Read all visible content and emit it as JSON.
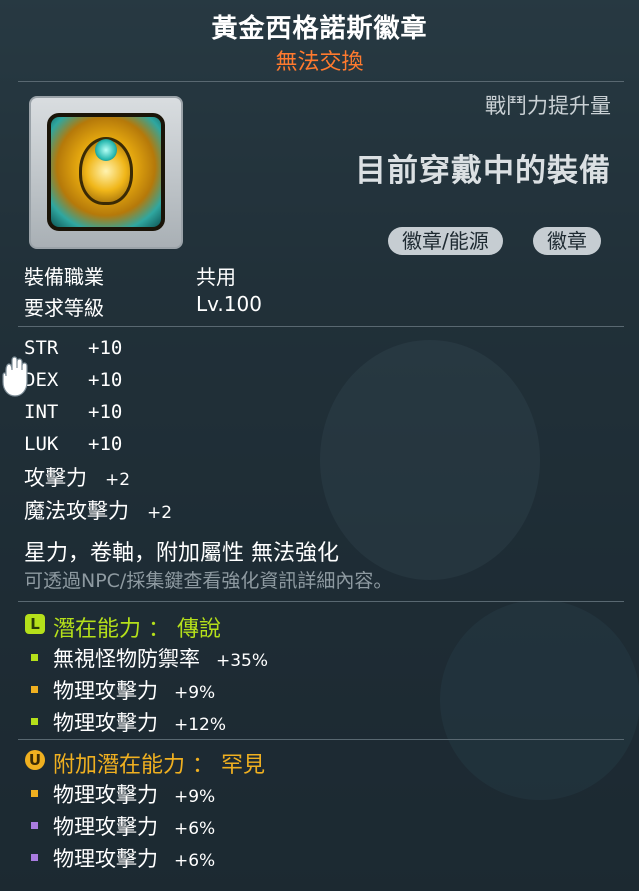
{
  "item": {
    "name": "黃金西格諾斯徽章",
    "trade_status": "無法交換",
    "icon": "golden-cygnus-badge-icon"
  },
  "power": {
    "label": "戰鬥力提升量",
    "equipped_text": "目前穿戴中的裝備"
  },
  "tags": [
    "徽章/能源",
    "徽章"
  ],
  "requirements": {
    "job_label": "裝備職業",
    "job_value": "共用",
    "level_label": "要求等級",
    "level_value": "Lv.100"
  },
  "stats": [
    {
      "name": "STR",
      "value": "+10"
    },
    {
      "name": "DEX",
      "value": "+10"
    },
    {
      "name": "INT",
      "value": "+10"
    },
    {
      "name": "LUK",
      "value": "+10"
    }
  ],
  "attack": {
    "label": "攻擊力",
    "value": "+2"
  },
  "magic_attack": {
    "label": "魔法攻擊力",
    "value": "+2"
  },
  "notes": "星力，卷軸，附加屬性 無法強化",
  "hint": "可透過NPC/採集鍵查看強化資訊詳細內容。",
  "potential": {
    "icon_letter": "L",
    "title": "潛在能力 ： 傳說",
    "color": "#b5e01a",
    "lines": [
      {
        "label": "無視怪物防禦率",
        "value": "+35%",
        "bullet_color": "#b5e01a"
      },
      {
        "label": "物理攻擊力",
        "value": "+9%",
        "bullet_color": "#f0b020"
      },
      {
        "label": "物理攻擊力",
        "value": "+12%",
        "bullet_color": "#b5e01a"
      }
    ]
  },
  "additional_potential": {
    "icon_letter": "U",
    "title": "附加潛在能力 ： 罕見",
    "color": "#f0b020",
    "lines": [
      {
        "label": "物理攻擊力",
        "value": "+9%",
        "bullet_color": "#f0b020"
      },
      {
        "label": "物理攻擊力",
        "value": "+6%",
        "bullet_color": "#a97ce0"
      },
      {
        "label": "物理攻擊力",
        "value": "+6%",
        "bullet_color": "#a97ce0"
      }
    ]
  }
}
